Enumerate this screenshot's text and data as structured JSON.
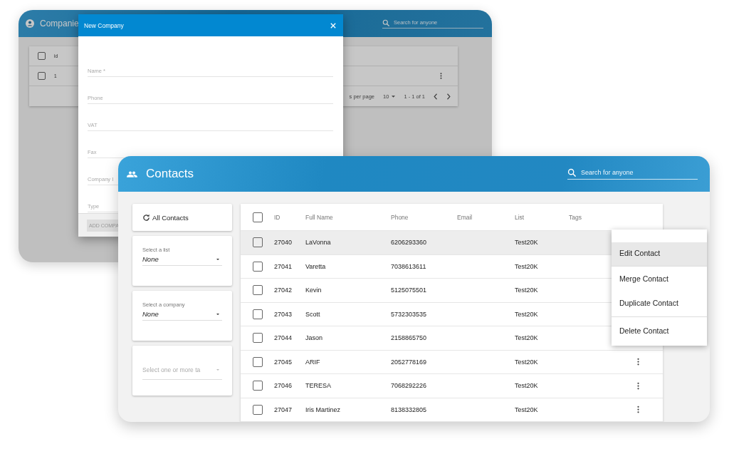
{
  "back_window": {
    "title": "Companie",
    "search": {
      "placeholder": "Search for anyone"
    },
    "table": {
      "columns": [
        "id"
      ],
      "header_checked": false,
      "rows": [
        {
          "cells": [
            "1"
          ],
          "checked": false
        }
      ],
      "footer": {
        "rows_per_page": "s per page",
        "page_size": "10",
        "range": "1 - 1 of 1"
      }
    },
    "dialog": {
      "title": "New Company",
      "fields": [
        {
          "label": "Name *"
        },
        {
          "label": "Phone"
        },
        {
          "label": "VAT"
        },
        {
          "label": "Fax"
        },
        {
          "label": "Company I"
        },
        {
          "label": "Type"
        }
      ],
      "button": "ADD COMPA"
    }
  },
  "front_window": {
    "title": "Contacts",
    "search": {
      "placeholder": "Search for anyone"
    },
    "sidebar": {
      "all_contacts": "All Contacts",
      "filters": [
        {
          "kind": "select",
          "label": "Select a list",
          "value": "None"
        },
        {
          "kind": "select",
          "label": "Select a company",
          "value": "None"
        },
        {
          "kind": "multi",
          "placeholder": "Select one or more ta"
        }
      ]
    },
    "table": {
      "columns": [
        "ID",
        "Full Name",
        "Phone",
        "Email",
        "List",
        "Tags"
      ],
      "header_checked": false,
      "rows": [
        {
          "id": "27040",
          "name": "LaVonna",
          "phone": "6206293360",
          "list": "Test20K",
          "checked": false,
          "highlighted": true
        },
        {
          "id": "27041",
          "name": "Varetta",
          "phone": "7038613611",
          "list": "Test20K",
          "checked": false,
          "highlighted": false
        },
        {
          "id": "27042",
          "name": "Kevin",
          "phone": "5125075501",
          "list": "Test20K",
          "checked": false,
          "highlighted": false
        },
        {
          "id": "27043",
          "name": "Scott",
          "phone": "5732303535",
          "list": "Test20K",
          "checked": false,
          "highlighted": false
        },
        {
          "id": "27044",
          "name": "Jason",
          "phone": "2158865750",
          "list": "Test20K",
          "checked": false,
          "highlighted": false
        },
        {
          "id": "27045",
          "name": "ARIF",
          "phone": "2052778169",
          "list": "Test20K",
          "checked": false,
          "highlighted": false
        },
        {
          "id": "27046",
          "name": "TERESA",
          "phone": "7068292226",
          "list": "Test20K",
          "checked": false,
          "highlighted": false
        },
        {
          "id": "27047",
          "name": "Iris Martinez",
          "phone": "8138332805",
          "list": "Test20K",
          "checked": false,
          "highlighted": false
        }
      ]
    },
    "context_menu": {
      "items": [
        {
          "label": "Edit Contact",
          "selected": true,
          "divider_before": false
        },
        {
          "label": "Merge Contact",
          "selected": false,
          "divider_before": false
        },
        {
          "label": "Duplicate Contact",
          "selected": false,
          "divider_before": false
        },
        {
          "label": "Delete Contact",
          "selected": false,
          "divider_before": true
        }
      ]
    }
  }
}
